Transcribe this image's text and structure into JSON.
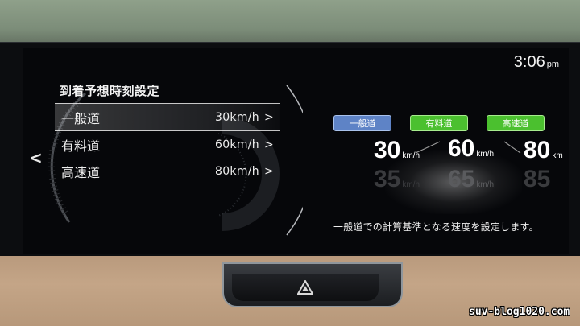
{
  "clock": {
    "time": "3:06",
    "ampm": "pm"
  },
  "menu": {
    "title": "到着予想時刻設定",
    "items": [
      {
        "label": "一般道",
        "value": "30km/h",
        "chevron": ">",
        "selected": true
      },
      {
        "label": "有料道",
        "value": "60km/h",
        "chevron": ">",
        "selected": false
      },
      {
        "label": "高速道",
        "value": "80km/h",
        "chevron": ">",
        "selected": false
      }
    ],
    "back": "<"
  },
  "preview": {
    "chips": [
      "一般道",
      "有料道",
      "高速道"
    ],
    "speeds": [
      {
        "value": "30",
        "unit": "km/h"
      },
      {
        "value": "60",
        "unit": "km/h"
      },
      {
        "value": "80",
        "unit": "km"
      }
    ],
    "ghost_speeds": [
      {
        "value": "35",
        "unit": "km/h"
      },
      {
        "value": "65",
        "unit": "km/h"
      },
      {
        "value": "85",
        "unit": ""
      }
    ],
    "description": "一般道での計算基準となる速度を設定します。"
  },
  "watermark": "suv-blog1020.com",
  "colors": {
    "chip_blue": "#5e83c6",
    "chip_green": "#4bc02f",
    "screen_bg": "#06070a",
    "dashboard": "#c4a587"
  },
  "icons": [
    "chevron-left-icon",
    "chevron-right-icon",
    "hazard-icon"
  ]
}
